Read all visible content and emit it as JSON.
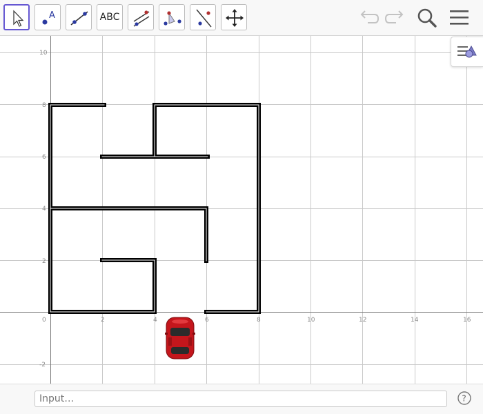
{
  "toolbar": {
    "tools": [
      {
        "name": "move-tool",
        "icon": "cursor-arrow-icon"
      },
      {
        "name": "point-tool",
        "icon": "point-a-icon"
      },
      {
        "name": "line-tool",
        "icon": "line-through-two-points-icon"
      },
      {
        "name": "text-tool",
        "icon": "text-icon",
        "label": "ABC"
      },
      {
        "name": "perpendicular-tool",
        "icon": "perpendicular-line-icon"
      },
      {
        "name": "angle-tool",
        "icon": "angle-icon"
      },
      {
        "name": "reflect-tool",
        "icon": "reflect-about-line-icon"
      },
      {
        "name": "move-graphics-view-tool",
        "icon": "move-arrows-icon"
      }
    ],
    "right": [
      "undo-icon",
      "redo-icon",
      "search-icon",
      "menu-icon"
    ]
  },
  "axes": {
    "x_ticks": [
      "0",
      "2",
      "4",
      "6",
      "8",
      "10",
      "12",
      "14",
      "16"
    ],
    "y_ticks": [
      "10",
      "8",
      "6",
      "4",
      "2",
      "-2"
    ]
  },
  "colors": {
    "selected_tool_border": "#6557d2",
    "grid": "#c8c8c8",
    "axis": "#7a7a7a",
    "wall": "#000000",
    "car": "#c4161c"
  },
  "style_bar": {
    "icon": "style-bar-toggle-icon"
  },
  "input": {
    "placeholder": "Input…"
  },
  "help": {
    "icon": "help-icon",
    "label": "?"
  }
}
